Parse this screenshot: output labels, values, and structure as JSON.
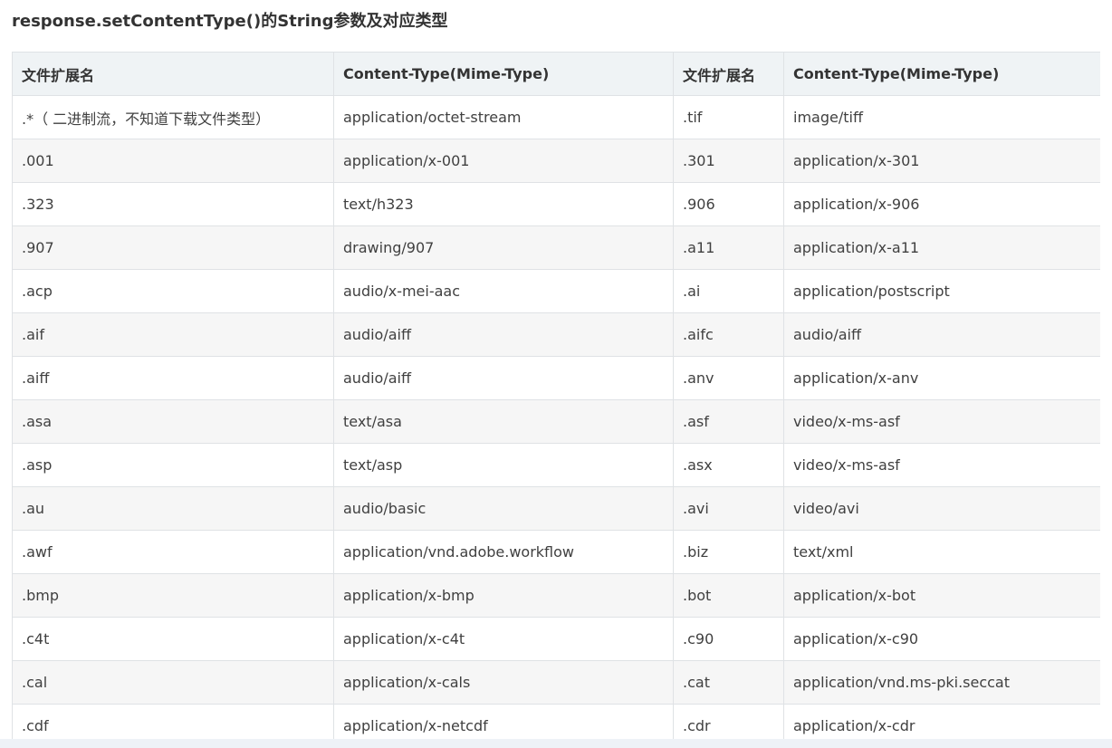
{
  "title": "response.setContentType()的String参数及对应类型",
  "table": {
    "headers": [
      "文件扩展名",
      "Content-Type(Mime-Type)",
      "文件扩展名",
      "Content-Type(Mime-Type)"
    ],
    "rows": [
      [
        ".*（ 二进制流，不知道下载文件类型）",
        "application/octet-stream",
        ".tif",
        "image/tiff"
      ],
      [
        ".001",
        "application/x-001",
        ".301",
        "application/x-301"
      ],
      [
        ".323",
        "text/h323",
        ".906",
        "application/x-906"
      ],
      [
        ".907",
        "drawing/907",
        ".a11",
        "application/x-a11"
      ],
      [
        ".acp",
        "audio/x-mei-aac",
        ".ai",
        "application/postscript"
      ],
      [
        ".aif",
        "audio/aiff",
        ".aifc",
        "audio/aiff"
      ],
      [
        ".aiff",
        "audio/aiff",
        ".anv",
        "application/x-anv"
      ],
      [
        ".asa",
        "text/asa",
        ".asf",
        "video/x-ms-asf"
      ],
      [
        ".asp",
        "text/asp",
        ".asx",
        "video/x-ms-asf"
      ],
      [
        ".au",
        "audio/basic",
        ".avi",
        "video/avi"
      ],
      [
        ".awf",
        "application/vnd.adobe.workflow",
        ".biz",
        "text/xml"
      ],
      [
        ".bmp",
        "application/x-bmp",
        ".bot",
        "application/x-bot"
      ],
      [
        ".c4t",
        "application/x-c4t",
        ".c90",
        "application/x-c90"
      ],
      [
        ".cal",
        "application/x-cals",
        ".cat",
        "application/vnd.ms-pki.seccat"
      ],
      [
        ".cdf",
        "application/x-netcdf",
        ".cdr",
        "application/x-cdr"
      ]
    ]
  }
}
